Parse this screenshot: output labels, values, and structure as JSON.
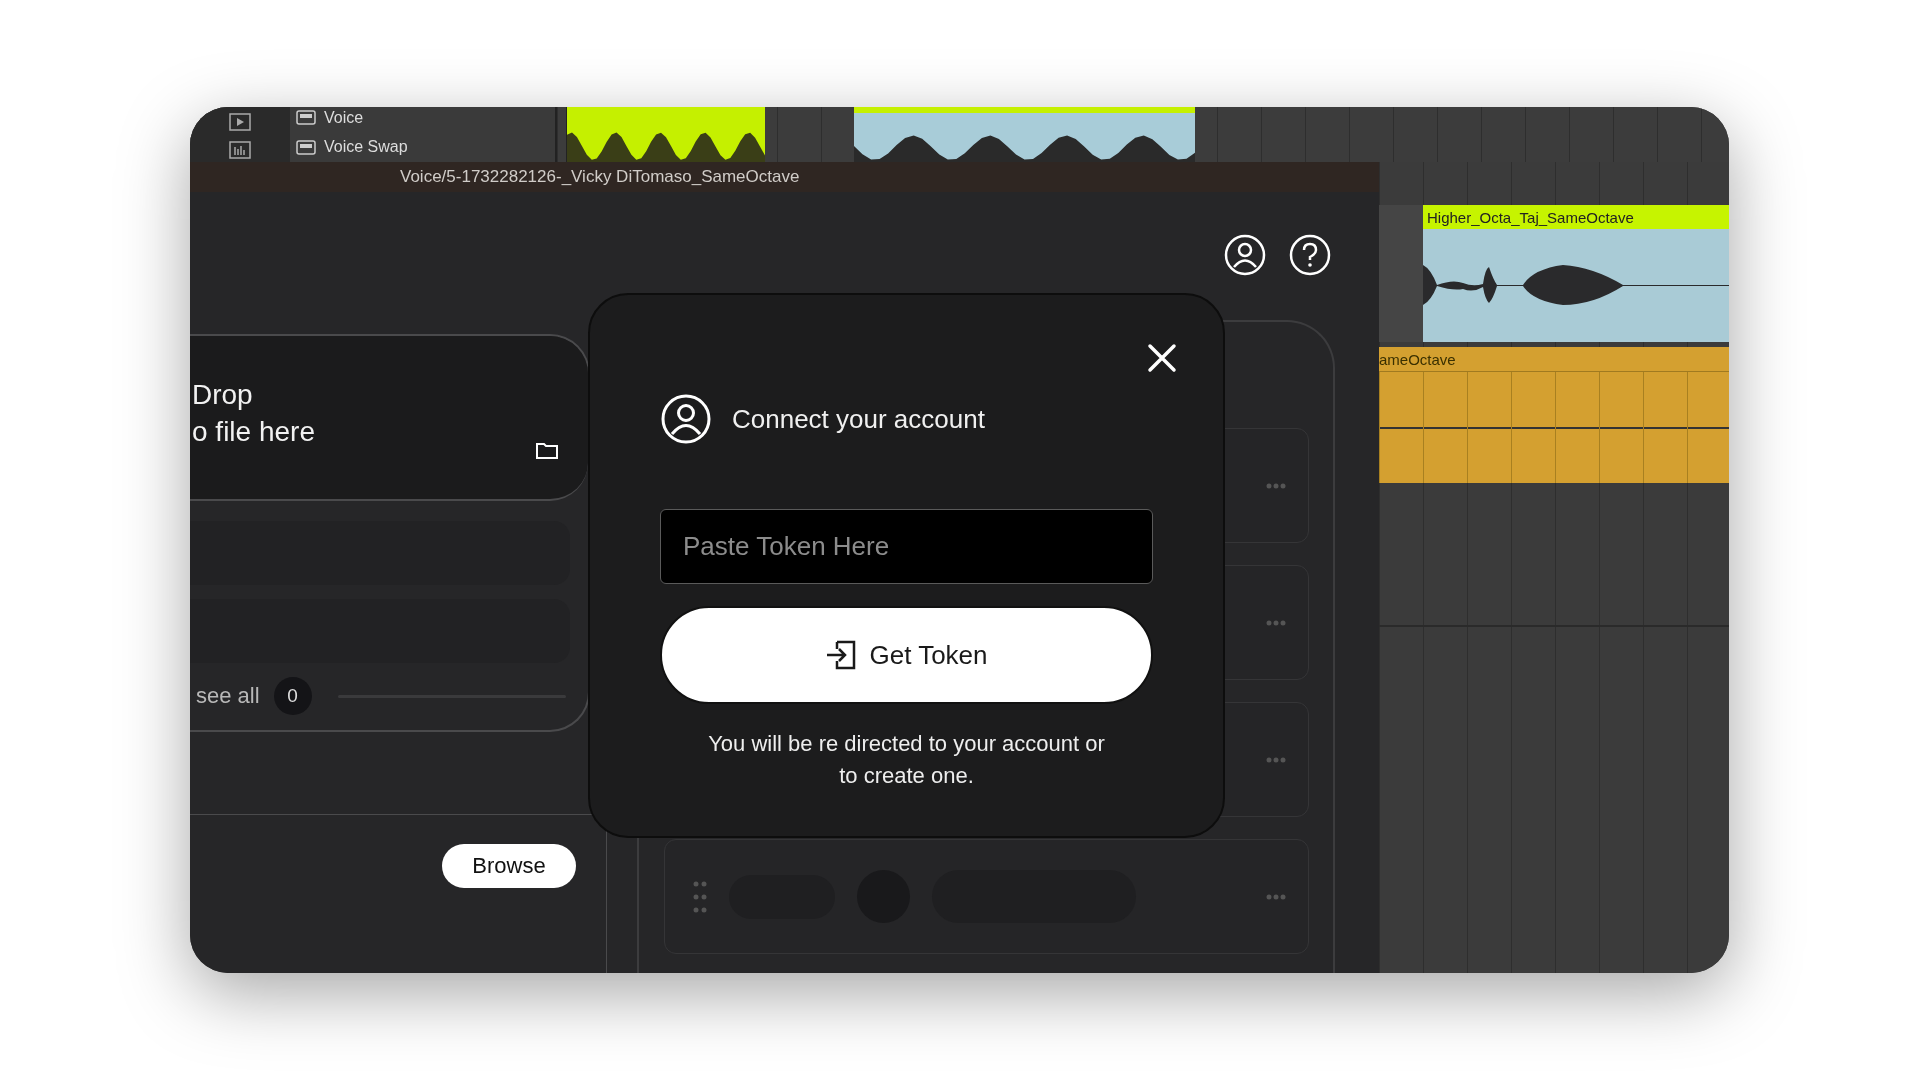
{
  "daw": {
    "tracks": [
      {
        "name": "Voice"
      },
      {
        "name": "Voice Swap"
      }
    ],
    "clips": [
      {
        "title": "Higher_Octa_Taj_SameOctave",
        "color": "#c6f400"
      },
      {
        "title": "ameOctave",
        "color": "#d4a030"
      }
    ]
  },
  "plugin_window": {
    "title": "Voice/5-1732282126-_Vicky DiTomaso_SameOctave",
    "drop_zone": {
      "lines": [
        "Drop",
        "o file here"
      ]
    },
    "see_all": {
      "label": "see all",
      "count": "0"
    },
    "browse_button": "Browse"
  },
  "modal": {
    "title": "Connect your account",
    "token_field": {
      "placeholder": "Paste Token Here"
    },
    "get_token_button": "Get Token",
    "note": "You will be re directed to your account or to create one."
  }
}
